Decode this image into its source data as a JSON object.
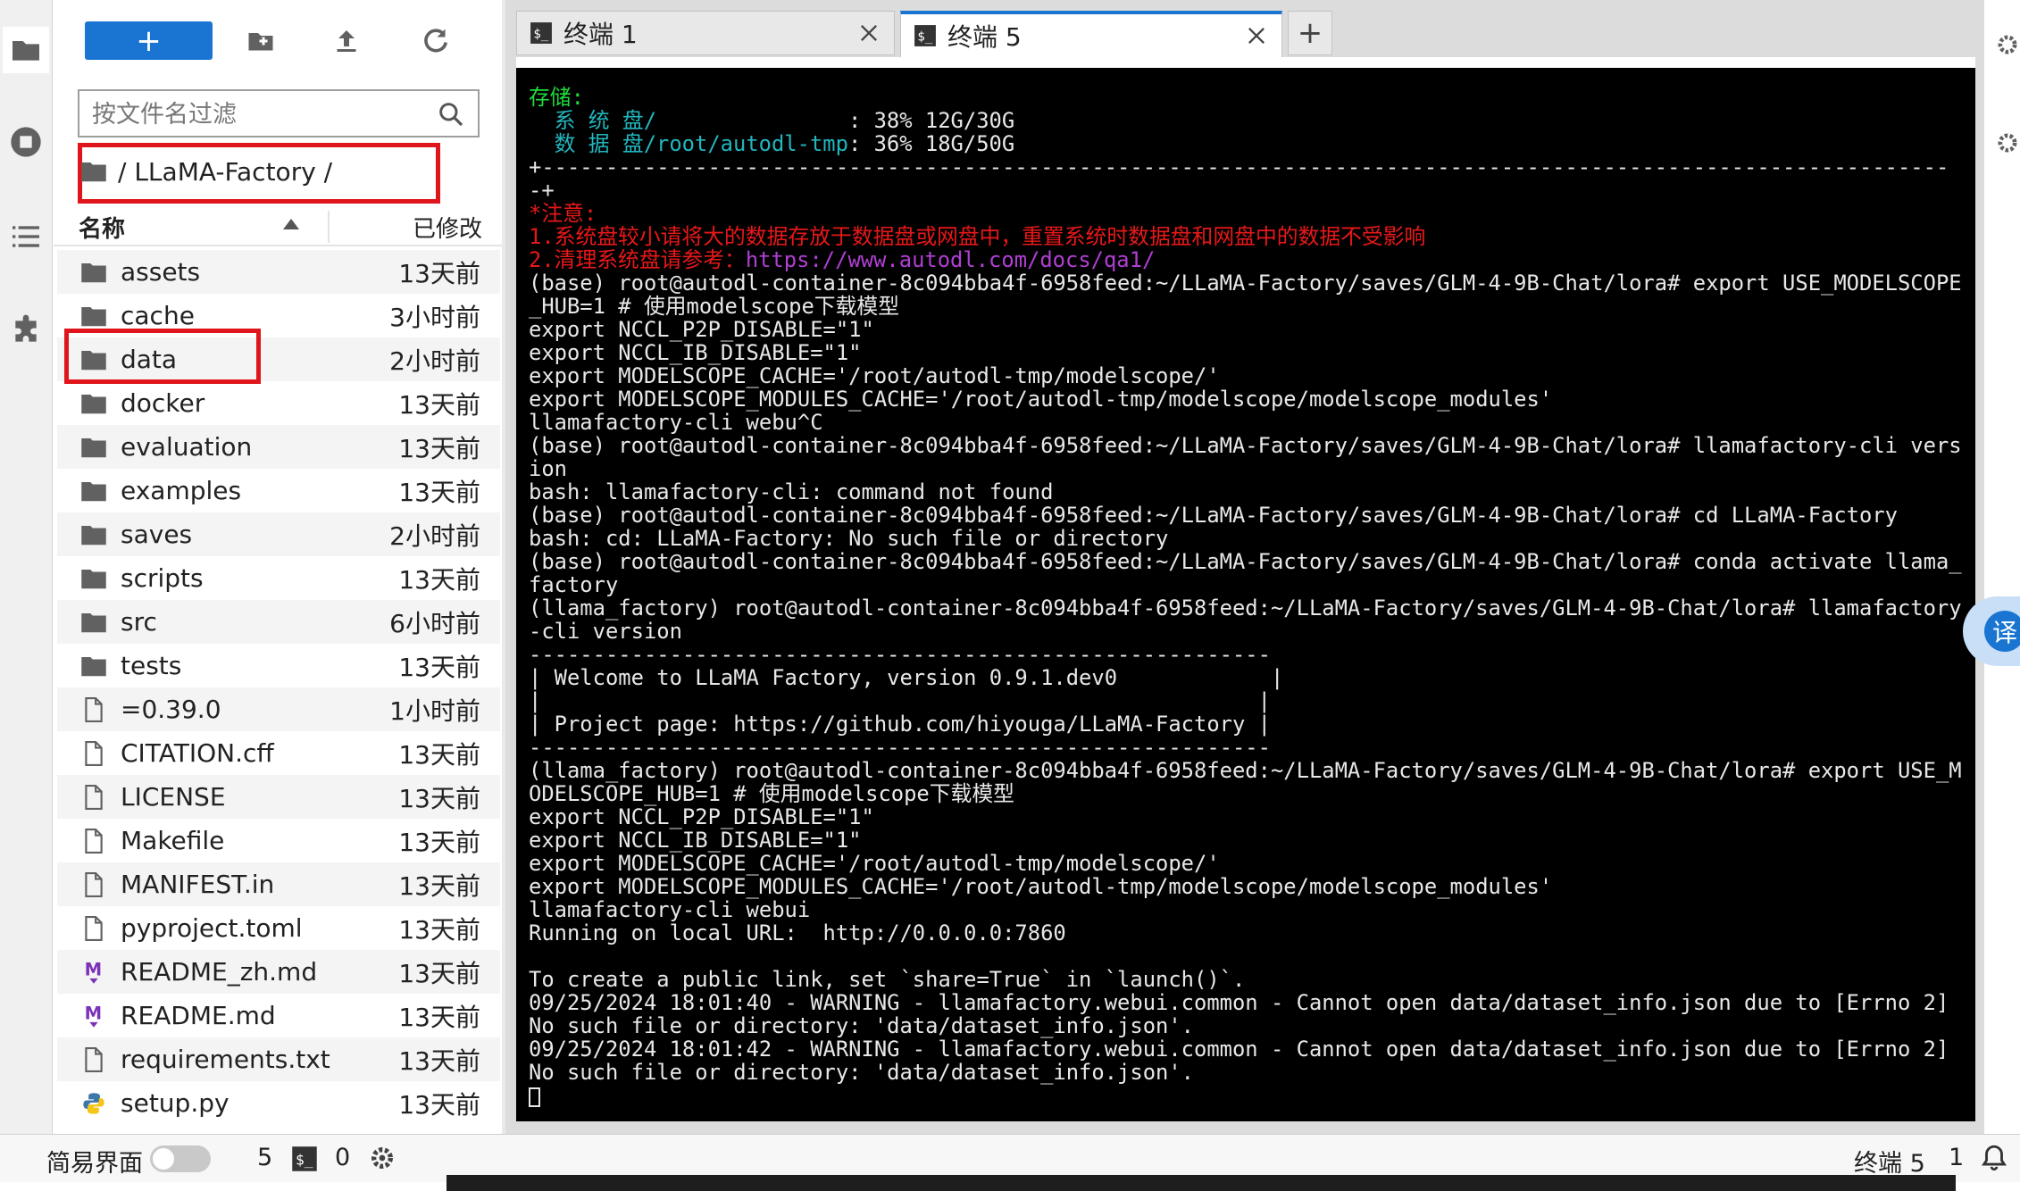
{
  "file_browser": {
    "new_button_label": "+",
    "filter_placeholder": "按文件名过滤",
    "breadcrumb": "/ LLaMA-Factory /",
    "header_name": "名称",
    "header_modified": "已修改",
    "files": [
      {
        "name": "assets",
        "modified": "13天前",
        "type": "folder"
      },
      {
        "name": "cache",
        "modified": "3小时前",
        "type": "folder"
      },
      {
        "name": "data",
        "modified": "2小时前",
        "type": "folder"
      },
      {
        "name": "docker",
        "modified": "13天前",
        "type": "folder"
      },
      {
        "name": "evaluation",
        "modified": "13天前",
        "type": "folder"
      },
      {
        "name": "examples",
        "modified": "13天前",
        "type": "folder"
      },
      {
        "name": "saves",
        "modified": "2小时前",
        "type": "folder"
      },
      {
        "name": "scripts",
        "modified": "13天前",
        "type": "folder"
      },
      {
        "name": "src",
        "modified": "6小时前",
        "type": "folder"
      },
      {
        "name": "tests",
        "modified": "13天前",
        "type": "folder"
      },
      {
        "name": "=0.39.0",
        "modified": "1小时前",
        "type": "file"
      },
      {
        "name": "CITATION.cff",
        "modified": "13天前",
        "type": "file"
      },
      {
        "name": "LICENSE",
        "modified": "13天前",
        "type": "file"
      },
      {
        "name": "Makefile",
        "modified": "13天前",
        "type": "file"
      },
      {
        "name": "MANIFEST.in",
        "modified": "13天前",
        "type": "file"
      },
      {
        "name": "pyproject.toml",
        "modified": "13天前",
        "type": "file"
      },
      {
        "name": "README_zh.md",
        "modified": "13天前",
        "type": "markdown"
      },
      {
        "name": "README.md",
        "modified": "13天前",
        "type": "markdown"
      },
      {
        "name": "requirements.txt",
        "modified": "13天前",
        "type": "file"
      },
      {
        "name": "setup.py",
        "modified": "13天前",
        "type": "python"
      }
    ]
  },
  "tabs": [
    {
      "label": "终端 1",
      "active": false
    },
    {
      "label": "终端 5",
      "active": true
    }
  ],
  "new_tab_label": "+",
  "terminal": {
    "lines": [
      [
        {
          "t": "存储:",
          "c": "green"
        }
      ],
      [
        {
          "t": "  系 统 盘/               ",
          "c": "cyan"
        },
        {
          "t": ": 38% 12G/30G",
          "c": ""
        }
      ],
      [
        {
          "t": "  数 据 盘/root/autodl-tmp",
          "c": "cyan"
        },
        {
          "t": ": 36% 18G/50G",
          "c": ""
        }
      ],
      [
        {
          "t": "+--------------------------------------------------------------------------------------------------------------",
          "c": ""
        }
      ],
      [
        {
          "t": "-+",
          "c": ""
        }
      ],
      [
        {
          "t": "*注意:",
          "c": "red"
        }
      ],
      [
        {
          "t": "1.系统盘较小请将大的数据存放于数据盘或网盘中，重置系统时数据盘和网盘中的数据不受影响",
          "c": "red"
        }
      ],
      [
        {
          "t": "2.清理系统盘请参考：",
          "c": "red"
        },
        {
          "t": "https://www.autodl.com/docs/qa1/",
          "c": "purple"
        }
      ],
      [
        {
          "t": "(base) root@autodl-container-8c094bba4f-6958feed:~/LLaMA-Factory/saves/GLM-4-9B-Chat/lora# export USE_MODELSCOPE",
          "c": ""
        }
      ],
      [
        {
          "t": "_HUB=1 # 使用modelscope下载模型",
          "c": ""
        }
      ],
      [
        {
          "t": "export NCCL_P2P_DISABLE=\"1\"",
          "c": ""
        }
      ],
      [
        {
          "t": "export NCCL_IB_DISABLE=\"1\"",
          "c": ""
        }
      ],
      [
        {
          "t": "export MODELSCOPE_CACHE='/root/autodl-tmp/modelscope/'",
          "c": ""
        }
      ],
      [
        {
          "t": "export MODELSCOPE_MODULES_CACHE='/root/autodl-tmp/modelscope/modelscope_modules'",
          "c": ""
        }
      ],
      [
        {
          "t": "llamafactory-cli webu^C",
          "c": ""
        }
      ],
      [
        {
          "t": "(base) root@autodl-container-8c094bba4f-6958feed:~/LLaMA-Factory/saves/GLM-4-9B-Chat/lora# llamafactory-cli vers",
          "c": ""
        }
      ],
      [
        {
          "t": "ion",
          "c": ""
        }
      ],
      [
        {
          "t": "bash: llamafactory-cli: command not found",
          "c": ""
        }
      ],
      [
        {
          "t": "(base) root@autodl-container-8c094bba4f-6958feed:~/LLaMA-Factory/saves/GLM-4-9B-Chat/lora# cd LLaMA-Factory",
          "c": ""
        }
      ],
      [
        {
          "t": "bash: cd: LLaMA-Factory: No such file or directory",
          "c": ""
        }
      ],
      [
        {
          "t": "(base) root@autodl-container-8c094bba4f-6958feed:~/LLaMA-Factory/saves/GLM-4-9B-Chat/lora# conda activate llama_",
          "c": ""
        }
      ],
      [
        {
          "t": "factory",
          "c": ""
        }
      ],
      [
        {
          "t": "(llama_factory) root@autodl-container-8c094bba4f-6958feed:~/LLaMA-Factory/saves/GLM-4-9B-Chat/lora# llamafactory",
          "c": ""
        }
      ],
      [
        {
          "t": "-cli version",
          "c": ""
        }
      ],
      [
        {
          "t": "----------------------------------------------------------",
          "c": ""
        }
      ],
      [
        {
          "t": "| Welcome to LLaMA Factory, version 0.9.1.dev0            |",
          "c": ""
        }
      ],
      [
        {
          "t": "|                                                        |",
          "c": ""
        }
      ],
      [
        {
          "t": "| Project page: https://github.com/hiyouga/LLaMA-Factory |",
          "c": ""
        }
      ],
      [
        {
          "t": "----------------------------------------------------------",
          "c": ""
        }
      ],
      [
        {
          "t": "(llama_factory) root@autodl-container-8c094bba4f-6958feed:~/LLaMA-Factory/saves/GLM-4-9B-Chat/lora# export USE_M",
          "c": ""
        }
      ],
      [
        {
          "t": "ODELSCOPE_HUB=1 # 使用modelscope下载模型",
          "c": ""
        }
      ],
      [
        {
          "t": "export NCCL_P2P_DISABLE=\"1\"",
          "c": ""
        }
      ],
      [
        {
          "t": "export NCCL_IB_DISABLE=\"1\"",
          "c": ""
        }
      ],
      [
        {
          "t": "export MODELSCOPE_CACHE='/root/autodl-tmp/modelscope/'",
          "c": ""
        }
      ],
      [
        {
          "t": "export MODELSCOPE_MODULES_CACHE='/root/autodl-tmp/modelscope/modelscope_modules'",
          "c": ""
        }
      ],
      [
        {
          "t": "llamafactory-cli webui",
          "c": ""
        }
      ],
      [
        {
          "t": "Running on local URL:  http://0.0.0.0:7860",
          "c": ""
        }
      ],
      [
        {
          "t": "",
          "c": ""
        }
      ],
      [
        {
          "t": "To create a public link, set `share=True` in `launch()`.",
          "c": ""
        }
      ],
      [
        {
          "t": "09/25/2024 18:01:40 - WARNING - llamafactory.webui.common - Cannot open data/dataset_info.json due to [Errno 2]",
          "c": ""
        }
      ],
      [
        {
          "t": "No such file or directory: 'data/dataset_info.json'.",
          "c": ""
        }
      ],
      [
        {
          "t": "09/25/2024 18:01:42 - WARNING - llamafactory.webui.common - Cannot open data/dataset_info.json due to [Errno 2]",
          "c": ""
        }
      ],
      [
        {
          "t": "No such file or directory: 'data/dataset_info.json'.",
          "c": ""
        }
      ]
    ]
  },
  "translate_label": "译",
  "status_bar": {
    "simple_mode_label": "简易界面",
    "kernel_count": "5",
    "terminal_count": "0",
    "active_terminal": "终端 5",
    "line_number": "1"
  },
  "colors": {
    "accent": "#1a75d2",
    "highlight_box": "#e0151b",
    "terminal_bg": "#000000",
    "terminal_green": "#1fdc3c",
    "terminal_cyan": "#22b6bd",
    "terminal_red": "#e81818"
  },
  "icons": {
    "activity": [
      "folder-icon",
      "stop-circle-icon",
      "list-icon",
      "puzzle-icon"
    ],
    "toolbar": [
      "new-folder-icon",
      "upload-icon",
      "refresh-icon"
    ]
  }
}
